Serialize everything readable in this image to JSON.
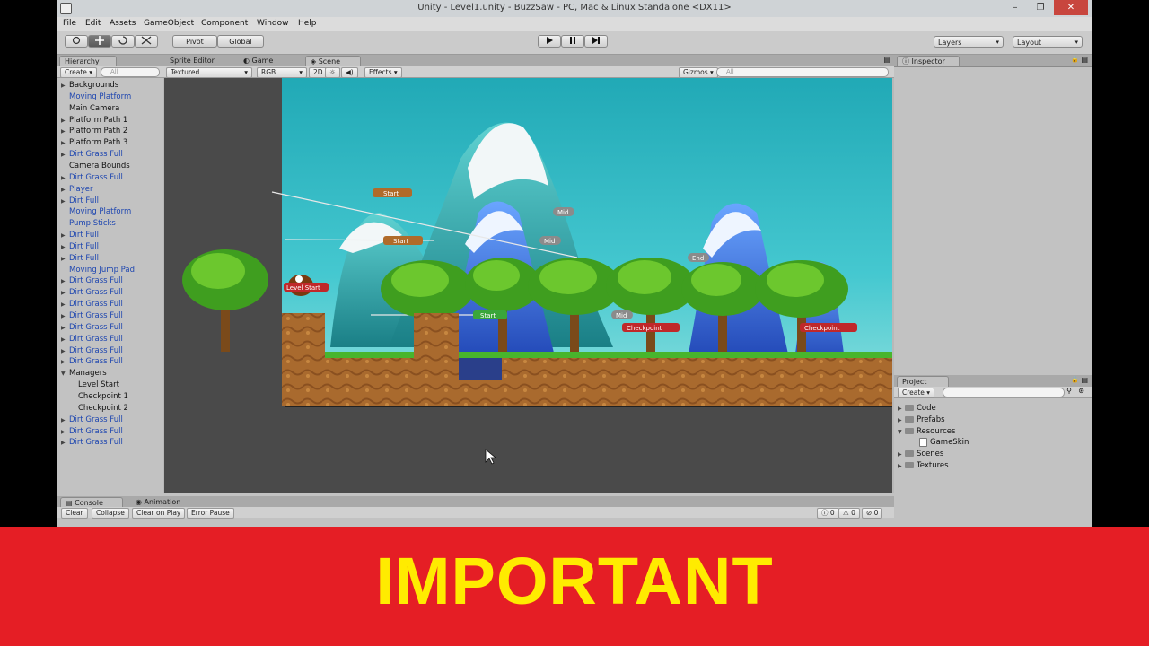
{
  "window": {
    "title": "Unity - Level1.unity - BuzzSaw - PC, Mac & Linux Standalone <DX11>",
    "minimize": "–",
    "maximize": "❐",
    "close": "✕"
  },
  "menu": [
    "File",
    "Edit",
    "Assets",
    "GameObject",
    "Component",
    "Window",
    "Help"
  ],
  "toolbar": {
    "transform_tools": [
      "hand-icon",
      "move-icon",
      "rotate-icon",
      "scale-icon"
    ],
    "pivot": "Pivot",
    "global": "Global",
    "play_icons": [
      "play-icon",
      "pause-icon",
      "step-icon"
    ],
    "layers": "Layers",
    "layout": "Layout"
  },
  "hierarchy": {
    "tab": "Hierarchy",
    "create": "Create",
    "search_placeholder": "All",
    "items": [
      {
        "label": "Backgrounds",
        "fold": "▶",
        "indent": 0,
        "prefab": false
      },
      {
        "label": "Moving Platform",
        "fold": "",
        "indent": 0,
        "prefab": true
      },
      {
        "label": "Main Camera",
        "fold": "",
        "indent": 0,
        "prefab": false
      },
      {
        "label": "Platform Path 1",
        "fold": "▶",
        "indent": 0,
        "prefab": false
      },
      {
        "label": "Platform Path 2",
        "fold": "▶",
        "indent": 0,
        "prefab": false
      },
      {
        "label": "Platform Path 3",
        "fold": "▶",
        "indent": 0,
        "prefab": false
      },
      {
        "label": "Dirt Grass Full",
        "fold": "▶",
        "indent": 0,
        "prefab": true
      },
      {
        "label": "Camera Bounds",
        "fold": "",
        "indent": 0,
        "prefab": false
      },
      {
        "label": "Dirt Grass Full",
        "fold": "▶",
        "indent": 0,
        "prefab": true
      },
      {
        "label": "Player",
        "fold": "▶",
        "indent": 0,
        "prefab": true
      },
      {
        "label": "Dirt Full",
        "fold": "▶",
        "indent": 0,
        "prefab": true
      },
      {
        "label": "Moving Platform",
        "fold": "",
        "indent": 0,
        "prefab": true
      },
      {
        "label": "Pump Sticks",
        "fold": "",
        "indent": 0,
        "prefab": true
      },
      {
        "label": "Dirt Full",
        "fold": "▶",
        "indent": 0,
        "prefab": true
      },
      {
        "label": "Dirt Full",
        "fold": "▶",
        "indent": 0,
        "prefab": true
      },
      {
        "label": "Dirt Full",
        "fold": "▶",
        "indent": 0,
        "prefab": true
      },
      {
        "label": "Moving Jump Pad",
        "fold": "",
        "indent": 0,
        "prefab": true
      },
      {
        "label": "Dirt Grass Full",
        "fold": "▶",
        "indent": 0,
        "prefab": true
      },
      {
        "label": "Dirt Grass Full",
        "fold": "▶",
        "indent": 0,
        "prefab": true
      },
      {
        "label": "Dirt Grass Full",
        "fold": "▶",
        "indent": 0,
        "prefab": true
      },
      {
        "label": "Dirt Grass Full",
        "fold": "▶",
        "indent": 0,
        "prefab": true
      },
      {
        "label": "Dirt Grass Full",
        "fold": "▶",
        "indent": 0,
        "prefab": true
      },
      {
        "label": "Dirt Grass Full",
        "fold": "▶",
        "indent": 0,
        "prefab": true
      },
      {
        "label": "Dirt Grass Full",
        "fold": "▶",
        "indent": 0,
        "prefab": true
      },
      {
        "label": "Dirt Grass Full",
        "fold": "▶",
        "indent": 0,
        "prefab": true
      },
      {
        "label": "Managers",
        "fold": "▼",
        "indent": 0,
        "prefab": false
      },
      {
        "label": "Level Start",
        "fold": "",
        "indent": 1,
        "prefab": false
      },
      {
        "label": "Checkpoint 1",
        "fold": "",
        "indent": 1,
        "prefab": false
      },
      {
        "label": "Checkpoint 2",
        "fold": "",
        "indent": 1,
        "prefab": false
      },
      {
        "label": "Dirt Grass Full",
        "fold": "▶",
        "indent": 0,
        "prefab": true
      },
      {
        "label": "Dirt Grass Full",
        "fold": "▶",
        "indent": 0,
        "prefab": true
      },
      {
        "label": "Dirt Grass Full",
        "fold": "▶",
        "indent": 0,
        "prefab": true
      }
    ]
  },
  "scene": {
    "tabs": [
      "Sprite Editor",
      "Game",
      "Scene"
    ],
    "active_tab": "Scene",
    "render_mode": "Textured",
    "color_mode": "RGB",
    "mode_2d": "2D",
    "effects": "Effects",
    "gizmos": "Gizmos",
    "search_placeholder": "All",
    "labels": {
      "start": "Start",
      "mid": "Mid",
      "end": "End",
      "level_start": "Level Start",
      "checkpoint": "Checkpoint"
    }
  },
  "inspector": {
    "tab": "Inspector"
  },
  "project": {
    "tab": "Project",
    "create": "Create",
    "items": [
      {
        "label": "Code",
        "indent": 0,
        "fold": "▶"
      },
      {
        "label": "Prefabs",
        "indent": 0,
        "fold": "▶"
      },
      {
        "label": "Resources",
        "indent": 0,
        "fold": "▼"
      },
      {
        "label": "GameSkin",
        "indent": 1,
        "fold": ""
      },
      {
        "label": "Scenes",
        "indent": 0,
        "fold": "▶"
      },
      {
        "label": "Textures",
        "indent": 0,
        "fold": "▶"
      }
    ]
  },
  "console": {
    "tabs": [
      "Console",
      "Animation"
    ],
    "buttons": [
      "Clear",
      "Collapse",
      "Clear on Play",
      "Error Pause"
    ],
    "counts": [
      "0",
      "0",
      "0"
    ]
  },
  "banner": {
    "text": "IMPORTANT"
  },
  "colors": {
    "banner_bg": "#e51e25",
    "banner_text": "#ffeb00",
    "prefab_text": "#1e46b0",
    "sky": "#27b8c4"
  }
}
